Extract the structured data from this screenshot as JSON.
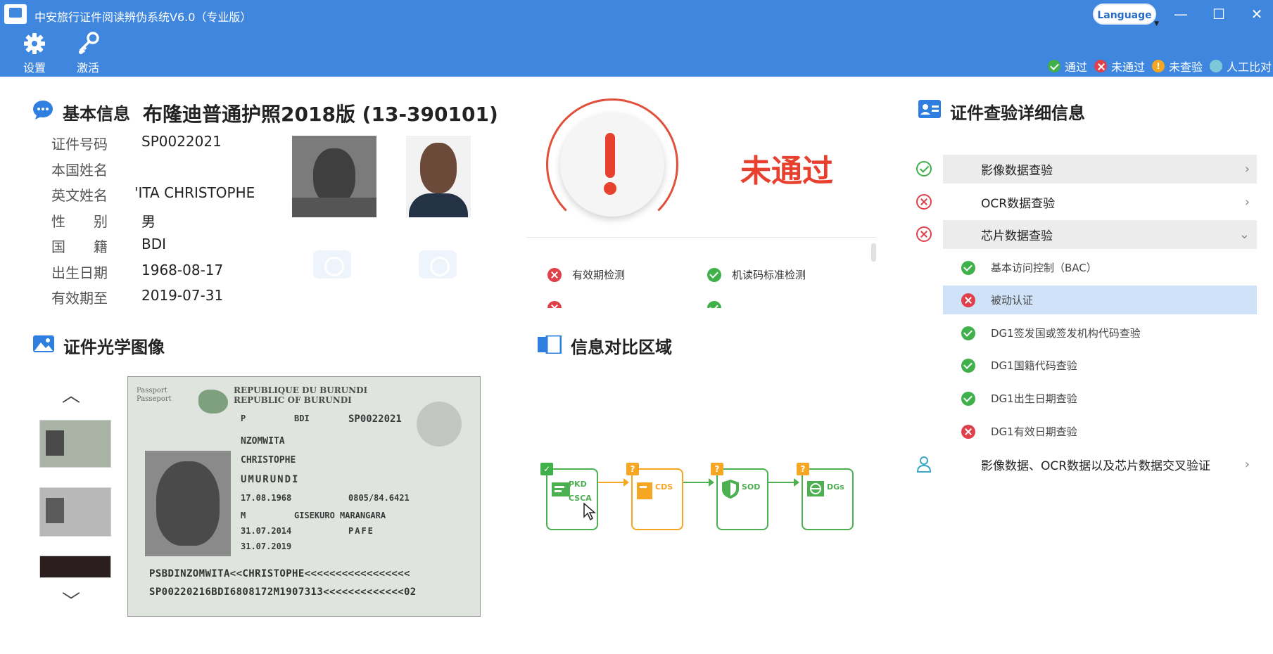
{
  "window": {
    "title": "中安旅行证件阅读辨伪系统V6.0（专业版）",
    "language_button": "Language",
    "minimize": "—",
    "maximize": "☐",
    "close": "✕"
  },
  "toolbar": {
    "settings_label": "设置",
    "activate_label": "激活"
  },
  "legend": {
    "pass": "通过",
    "fail": "未通过",
    "unchecked": "未查验",
    "manual": "人工比对"
  },
  "basic_info": {
    "section_label": "基本信息",
    "document_type": "布隆迪普通护照2018版 (13-390101)",
    "fields": [
      {
        "label": "证件号码",
        "value": "SP0022021"
      },
      {
        "label": "本国姓名",
        "value": ""
      },
      {
        "label": "英文姓名",
        "value": "'ITA  CHRISTOPHE"
      },
      {
        "label": "性　　别",
        "value": "男"
      },
      {
        "label": "国　　籍",
        "value": "BDI"
      },
      {
        "label": "出生日期",
        "value": "1968-08-17"
      },
      {
        "label": "有效期至",
        "value": "2019-07-31"
      }
    ]
  },
  "result": {
    "status_text": "未通过",
    "checks": [
      {
        "label": "有效期检测",
        "state": "fail"
      },
      {
        "label": "机读码标准检测",
        "state": "pass"
      }
    ]
  },
  "optical": {
    "section_label": "证件光学图像",
    "passport": {
      "header_line1": "REPUBLIQUE DU BURUNDI",
      "header_line2": "REPUBLIC OF BURUNDI",
      "side_label_1": "Passport",
      "side_label_2": "Passeport",
      "type": "P",
      "country": "BDI",
      "number": "SP0022021",
      "surname": "NZOMWITA",
      "given_name": "CHRISTOPHE",
      "nationality": "UMURUNDI",
      "birth_date": "17.08.1968",
      "personal_no": "0805/84.6421",
      "sex": "M",
      "birth_place": "GISEKURO  MARANGARA",
      "issue_date": "31.07.2014",
      "authority": "PAFE",
      "expiry_date": "31.07.2019",
      "mrz1": "PSBDINZOMWITA<<CHRISTOPHE<<<<<<<<<<<<<<<<<",
      "mrz2": "SP00220216BDI6808172M1907313<<<<<<<<<<<<<02"
    }
  },
  "compare": {
    "section_label": "信息对比区域",
    "flow": [
      {
        "label1": "PKD",
        "label2": "CSCA",
        "badge": "✓",
        "state": "pass"
      },
      {
        "label1": "CDS",
        "label2": "",
        "badge": "?",
        "state": "unchecked"
      },
      {
        "label1": "SOD",
        "label2": "",
        "badge": "?",
        "state": "unchecked"
      },
      {
        "label1": "DGs",
        "label2": "",
        "badge": "?",
        "state": "unchecked"
      }
    ]
  },
  "details": {
    "section_label": "证件查验详细信息",
    "groups": [
      {
        "label": "影像数据查验",
        "state": "pass"
      },
      {
        "label": "OCR数据查验",
        "state": "fail"
      },
      {
        "label": "芯片数据查验",
        "state": "fail"
      }
    ],
    "chip_items": [
      {
        "label": "基本访问控制（BAC）",
        "state": "pass"
      },
      {
        "label": "被动认证",
        "state": "fail"
      },
      {
        "label": "DG1签发国或签发机构代码查验",
        "state": "pass"
      },
      {
        "label": "DG1国籍代码查验",
        "state": "pass"
      },
      {
        "label": "DG1出生日期查验",
        "state": "pass"
      },
      {
        "label": "DG1有效日期查验",
        "state": "fail"
      }
    ],
    "cross_check": "影像数据、OCR数据以及芯片数据交叉验证"
  },
  "colors": {
    "accent": "#3f86de",
    "pass": "#3fb04a",
    "fail": "#e0404a",
    "warn": "#f5a623",
    "selected_row": "#cfe2f7"
  }
}
